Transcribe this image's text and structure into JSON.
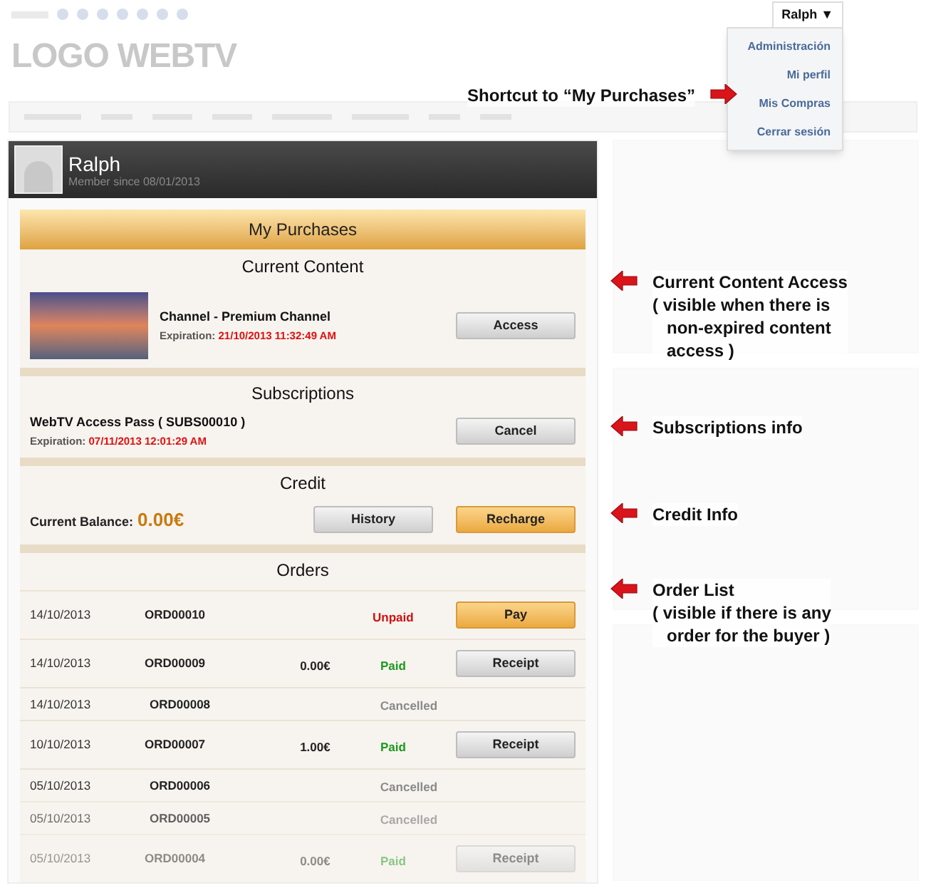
{
  "logo": "LOGO WEBTV",
  "user_menu": {
    "label": "Ralph ▼",
    "items": [
      {
        "label": "Administración"
      },
      {
        "label": "Mi perfil"
      },
      {
        "label": "Mis Compras"
      },
      {
        "label": "Cerrar sesión"
      }
    ]
  },
  "profile": {
    "name": "Ralph",
    "member_since": "Member since 08/01/2013"
  },
  "purchases": {
    "title": "My Purchases",
    "current_content": {
      "title": "Current Content",
      "name": "Channel - Premium Channel",
      "expiration_label": "Expiration:",
      "expiration": "21/10/2013 11:32:49 AM",
      "button": {
        "label": "Access",
        "kind": "default"
      }
    },
    "subscriptions": {
      "title": "Subscriptions",
      "name": "WebTV Access Pass ( SUBS00010 )",
      "expiration_label": "Expiration:",
      "expiration": "07/11/2013 12:01:29 AM",
      "button": {
        "label": "Cancel",
        "kind": "default"
      }
    },
    "credit": {
      "title": "Credit",
      "balance_label": "Current Balance:",
      "balance": "0.00€",
      "buttons": [
        {
          "label": "History",
          "kind": "default"
        },
        {
          "label": "Recharge",
          "kind": "primary"
        }
      ]
    },
    "orders": {
      "title": "Orders",
      "rows": [
        {
          "date": "14/10/2013",
          "id": "ORD00010",
          "status": "Unpaid",
          "kind": "unpaid",
          "action": {
            "label": "Pay",
            "kind": "primary"
          }
        },
        {
          "date": "14/10/2013",
          "id": "ORD00009",
          "amount": "0.00€",
          "status": "Paid",
          "kind": "paid",
          "action": {
            "label": "Receipt",
            "kind": "default"
          }
        },
        {
          "date": "14/10/2013",
          "id": "ORD00008",
          "status": "Cancelled",
          "kind": "cancelled"
        },
        {
          "date": "10/10/2013",
          "id": "ORD00007",
          "amount": "1.00€",
          "status": "Paid",
          "kind": "paid",
          "action": {
            "label": "Receipt",
            "kind": "default"
          }
        },
        {
          "date": "05/10/2013",
          "id": "ORD00006",
          "status": "Cancelled",
          "kind": "cancelled"
        },
        {
          "date": "05/10/2013",
          "id": "ORD00005",
          "status": "Cancelled",
          "kind": "cancelled"
        },
        {
          "date": "05/10/2013",
          "id": "ORD00004",
          "amount": "0.00€",
          "status": "Paid",
          "kind": "paid",
          "action": {
            "label": "Receipt",
            "kind": "default"
          }
        }
      ]
    }
  },
  "annotations": [
    {
      "lines": [
        "Shortcut to “My Purchases”"
      ],
      "kind": "right"
    },
    {
      "lines": [
        "Current Content Access",
        "( visible when there is",
        "non-expired content",
        "access )"
      ],
      "kind": "left"
    },
    {
      "lines": [
        "Subscriptions info"
      ],
      "kind": "left"
    },
    {
      "lines": [
        "Credit Info"
      ],
      "kind": "left"
    },
    {
      "lines": [
        "Order List",
        "( visible if there is any",
        "order for the buyer )"
      ],
      "kind": "left"
    }
  ]
}
